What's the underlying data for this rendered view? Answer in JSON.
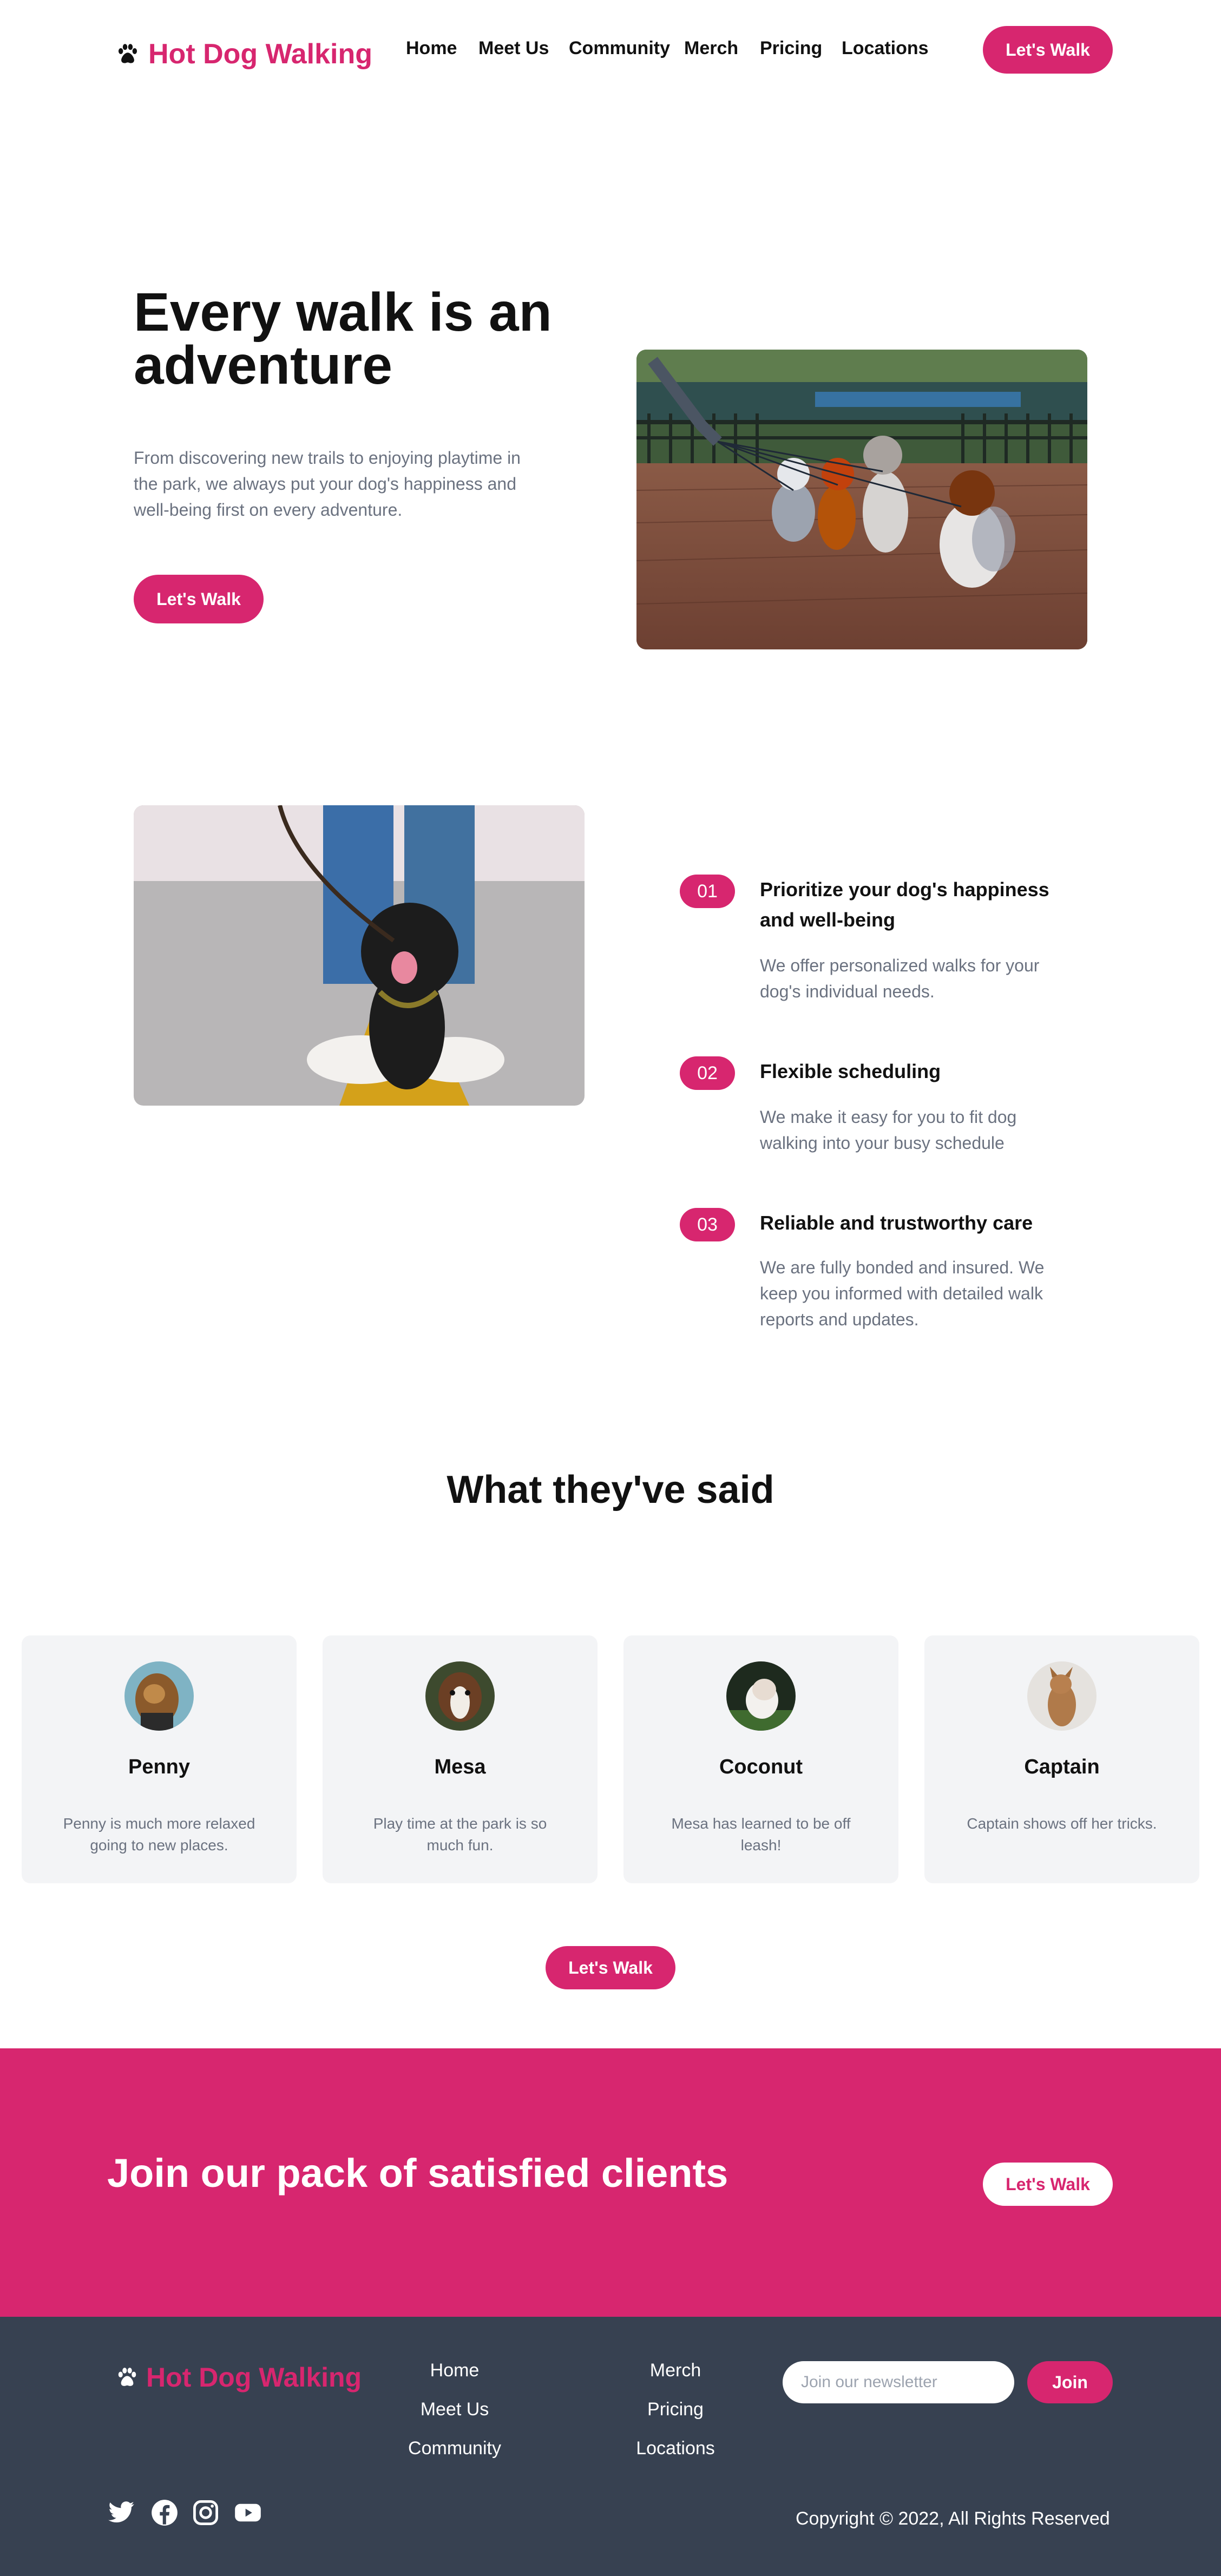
{
  "header": {
    "brand": "Hot Dog Walking",
    "nav": [
      "Home",
      "Meet Us",
      "Community",
      "Merch",
      "Pricing",
      "Locations"
    ],
    "cta_label": "Let's Walk"
  },
  "hero": {
    "title": "Every walk is an adventure",
    "text": "From discovering new trails to enjoying playtime in the park, we always put your dog's happiness and well-being first on every adventure.",
    "cta_label": "Let's Walk"
  },
  "features": [
    {
      "number": "01",
      "title": "Prioritize your dog's happiness and well-being",
      "text": "We offer personalized walks for your dog's individual needs."
    },
    {
      "number": "02",
      "title": "Flexible scheduling",
      "text": "We make it easy for you to fit dog walking into your busy schedule"
    },
    {
      "number": "03",
      "title": "Reliable and trustworthy care",
      "text": "We are fully bonded and insured. We keep you informed with detailed walk reports and updates."
    }
  ],
  "testimonials": {
    "title": "What they've said",
    "items": [
      {
        "name": "Penny",
        "quote": "Penny is much more relaxed going to new places."
      },
      {
        "name": "Mesa",
        "quote": "Play time at the park is so much fun."
      },
      {
        "name": "Coconut",
        "quote": "Mesa has learned to be off leash!"
      },
      {
        "name": "Captain",
        "quote": "Captain shows off her tricks."
      }
    ],
    "cta_label": "Let's Walk"
  },
  "cta": {
    "title": "Join our pack of satisfied clients",
    "button_label": "Let's Walk"
  },
  "footer": {
    "brand": "Hot Dog Walking",
    "links_col1": [
      "Home",
      "Meet Us",
      "Community"
    ],
    "links_col2": [
      "Merch",
      "Pricing",
      "Locations"
    ],
    "newsletter_placeholder": "Join our newsletter",
    "join_label": "Join",
    "social_icons": [
      "twitter-icon",
      "facebook-icon",
      "instagram-icon",
      "youtube-icon"
    ],
    "copyright": "Copyright © 2022, All Rights Reserved"
  },
  "colors": {
    "accent": "#d7266f",
    "footer_bg": "#374151",
    "muted_text": "#6b7280",
    "card_bg": "#f3f4f6"
  }
}
